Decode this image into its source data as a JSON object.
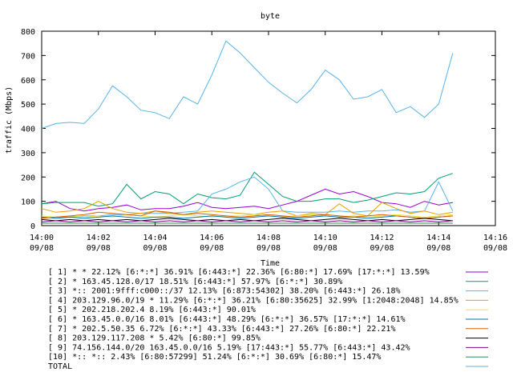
{
  "chart_data": {
    "type": "line",
    "title": "byte",
    "xlabel": "Time",
    "ylabel": "traffic (Mbps)",
    "ylim": [
      0,
      800
    ],
    "yticks": [
      "0",
      "100",
      "200",
      "300",
      "400",
      "500",
      "600",
      "700",
      "800"
    ],
    "xticks": [
      {
        "time": "14:00",
        "date": "09/08"
      },
      {
        "time": "14:02",
        "date": "09/08"
      },
      {
        "time": "14:04",
        "date": "09/08"
      },
      {
        "time": "14:06",
        "date": "09/08"
      },
      {
        "time": "14:08",
        "date": "09/08"
      },
      {
        "time": "14:10",
        "date": "09/08"
      },
      {
        "time": "14:12",
        "date": "09/08"
      },
      {
        "time": "14:14",
        "date": "09/08"
      },
      {
        "time": "14:16",
        "date": "09/08"
      }
    ],
    "x_minutes": [
      0,
      0.5,
      1,
      1.5,
      2,
      2.5,
      3,
      3.5,
      4,
      4.5,
      5,
      5.5,
      6,
      6.5,
      7,
      7.5,
      8,
      8.5,
      9,
      9.5,
      10,
      10.5,
      11,
      11.5,
      12,
      12.5,
      13,
      13.5,
      14,
      14.5
    ],
    "legend_position": "below",
    "series": [
      {
        "name": "[ 1] * * 22.12%  [6:*:*] 36.91% [6:443:*] 22.36% [6:80:*] 17.69% [17:*:*] 13.59%",
        "color": "#9400d3",
        "values": [
          90,
          100,
          70,
          60,
          70,
          75,
          85,
          65,
          70,
          70,
          80,
          95,
          75,
          70,
          75,
          80,
          70,
          85,
          100,
          125,
          150,
          130,
          140,
          120,
          95,
          90,
          75,
          100,
          85,
          95
        ]
      },
      {
        "name": "[ 2] * 163.45.128.0/17 18.51%  [6:443:*] 57.97% [6:*:*] 30.89%",
        "color": "#009e73",
        "values": [
          90,
          95,
          95,
          95,
          80,
          90,
          170,
          110,
          140,
          130,
          90,
          130,
          115,
          110,
          125,
          220,
          170,
          120,
          100,
          100,
          110,
          110,
          95,
          105,
          120,
          135,
          130,
          140,
          195,
          215
        ]
      },
      {
        "name": "[ 3] *:: 2001:9fff:c000::/37 12.13%  [6:873:54302] 38.20% [6:443:*] 26.18%",
        "color": "#56b4e9",
        "values": [
          30,
          35,
          35,
          40,
          40,
          45,
          45,
          50,
          50,
          50,
          55,
          60,
          130,
          150,
          180,
          200,
          150,
          60,
          55,
          55,
          55,
          60,
          55,
          60,
          60,
          65,
          55,
          60,
          180,
          60
        ]
      },
      {
        "name": "[ 4] 203.129.96.0/19 * 11.29%  [6:*:*] 36.21% [6:80:35625] 32.99% [1:2048:2048] 14.85%",
        "color": "#e69f00",
        "values": [
          70,
          55,
          60,
          70,
          100,
          70,
          55,
          50,
          60,
          50,
          45,
          55,
          60,
          55,
          50,
          45,
          55,
          60,
          40,
          50,
          45,
          90,
          50,
          40,
          95,
          70,
          50,
          60,
          45,
          55
        ]
      },
      {
        "name": "[ 5] * 202.218.202.4 8.19%  [6:443:*] 90.01%",
        "color": "#f0e442",
        "values": [
          40,
          35,
          40,
          35,
          40,
          35,
          45,
          40,
          35,
          40,
          45,
          40,
          35,
          40,
          40,
          45,
          40,
          35,
          40,
          45,
          40,
          35,
          40,
          35,
          40,
          45,
          40,
          35,
          40,
          45
        ]
      },
      {
        "name": "[ 6] * 163.45.0.0/16 8.01%  [6:443:*] 48.29% [6:*:*] 36.57% [17:*:*] 14.61%",
        "color": "#0072b2",
        "values": [
          35,
          30,
          35,
          30,
          35,
          40,
          35,
          30,
          35,
          35,
          30,
          35,
          40,
          35,
          30,
          35,
          40,
          35,
          30,
          35,
          40,
          35,
          35,
          30,
          35,
          40,
          35,
          30,
          35,
          40
        ]
      },
      {
        "name": "[ 7] * 202.5.50.35 6.72%  [6:*:*] 43.33% [6:443:*] 27.26% [6:80:*] 22.21%",
        "color": "#d55e00",
        "values": [
          30,
          35,
          40,
          45,
          55,
          50,
          45,
          40,
          60,
          55,
          45,
          50,
          45,
          40,
          35,
          40,
          45,
          40,
          35,
          40,
          45,
          40,
          35,
          40,
          45,
          40,
          35,
          30,
          35,
          40
        ]
      },
      {
        "name": "[ 8] 203.129.117.208 * 5.42%  [6:80:*] 99.85%",
        "color": "#000000",
        "values": [
          25,
          20,
          25,
          20,
          25,
          20,
          25,
          20,
          25,
          30,
          25,
          20,
          25,
          20,
          25,
          20,
          25,
          30,
          25,
          20,
          25,
          30,
          25,
          20,
          25,
          20,
          25,
          30,
          25,
          20
        ]
      },
      {
        "name": "[ 9] 74.156.144.0/20 163.45.0.0/16 5.19%  [17:443:*] 55.77% [6:443:*] 43.42%",
        "color": "#8b008b",
        "values": [
          15,
          20,
          15,
          20,
          15,
          20,
          15,
          20,
          15,
          20,
          15,
          20,
          15,
          20,
          15,
          20,
          15,
          20,
          15,
          20,
          15,
          20,
          15,
          20,
          15,
          20,
          15,
          20,
          15,
          20
        ]
      },
      {
        "name": "[10] *:: *:: 2.43%  [6:80:57299] 51.24% [6:*:*] 30.69% [6:80:*] 15.47%",
        "color": "#2e8b57",
        "values": [
          10,
          10,
          10,
          10,
          10,
          10,
          10,
          10,
          10,
          10,
          10,
          10,
          10,
          10,
          10,
          10,
          10,
          10,
          10,
          10,
          10,
          10,
          10,
          10,
          10,
          10,
          10,
          10,
          10,
          10
        ]
      },
      {
        "name": "TOTAL",
        "color": "#56b4e9",
        "values": [
          400,
          420,
          425,
          420,
          480,
          575,
          530,
          475,
          465,
          440,
          530,
          500,
          620,
          760,
          710,
          650,
          590,
          545,
          505,
          560,
          640,
          600,
          520,
          530,
          560,
          465,
          490,
          445,
          500,
          710
        ]
      }
    ]
  }
}
